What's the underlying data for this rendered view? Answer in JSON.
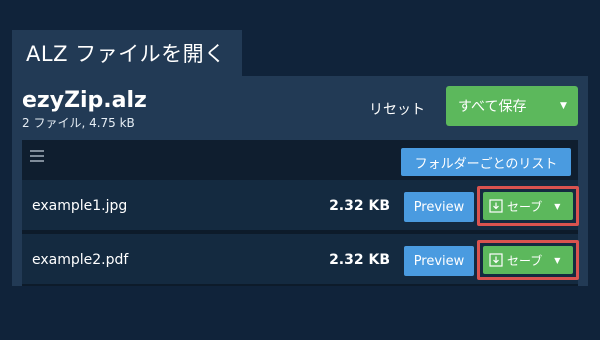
{
  "tab": {
    "title": "ALZ ファイルを開く"
  },
  "archive": {
    "name": "ezyZip.alz",
    "meta": "2 ファイル, 4.75 kB"
  },
  "actions": {
    "reset_label": "リセット",
    "save_all_label": "すべて保存"
  },
  "toolbar": {
    "folder_list_label": "フォルダーごとのリスト"
  },
  "files": [
    {
      "name": "example1.jpg",
      "size": "2.32 KB",
      "preview_label": "Preview",
      "save_label": "セーブ"
    },
    {
      "name": "example2.pdf",
      "size": "2.32 KB",
      "preview_label": "Preview",
      "save_label": "セーブ"
    }
  ],
  "colors": {
    "background": "#10233a",
    "panel": "#223a55",
    "green": "#5cb85c",
    "blue": "#4a9be0",
    "highlight_border": "#d9534f"
  }
}
